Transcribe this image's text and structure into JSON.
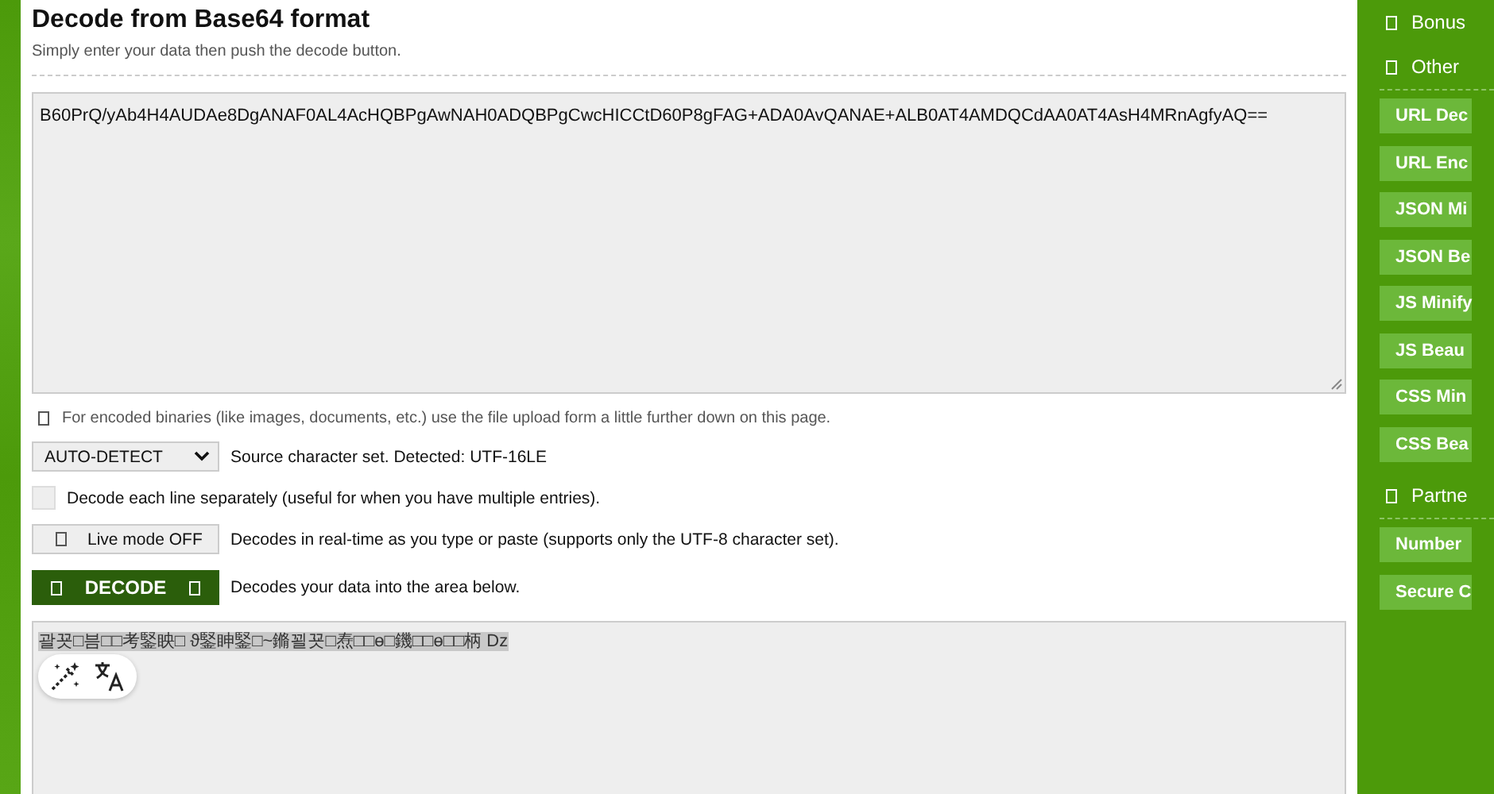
{
  "header": {
    "title": "Decode from Base64 format",
    "subtitle": "Simply enter your data then push the decode button."
  },
  "input": {
    "value": "B60PrQ/yAb4H4AUDAe8DgANAF0AL4AcHQBPgAwNAH0ADQBPgCwcHICCtD60P8gFAG+ADA0AvQANAE+ALB0AT4AMDQCdAA0AT4AsH4MRnAgfyAQ=="
  },
  "note": "For encoded binaries (like images, documents, etc.) use the file upload form a little further down on this page.",
  "charset": {
    "value": "AUTO-DETECT",
    "label": "Source character set. Detected: UTF-16LE"
  },
  "each_line": {
    "checked": false,
    "label": "Decode each line separately (useful for when you have multiple entries)."
  },
  "live_mode": {
    "label": "Live mode OFF",
    "on": false,
    "description": "Decodes in real-time as you type or paste (supports only the UTF-8 character set)."
  },
  "decode": {
    "label": "DECODE",
    "description": "Decodes your data into the area below."
  },
  "output": {
    "value": "괄꾯□븜□□考鋻眏□ ϑ鋻眒鋻□~鏅꾈꾯□焘□□ɵ□鐖□□ɵ□□柄 Dz"
  },
  "sidebar": [
    {
      "kind": "heading",
      "label": "Bonus"
    },
    {
      "kind": "heading",
      "label": "Other"
    },
    {
      "kind": "link",
      "label": "URL Dec"
    },
    {
      "kind": "link",
      "label": "URL Enc"
    },
    {
      "kind": "link",
      "label": "JSON Mi"
    },
    {
      "kind": "link",
      "label": "JSON Be"
    },
    {
      "kind": "link",
      "label": "JS Minify"
    },
    {
      "kind": "link",
      "label": "JS Beau"
    },
    {
      "kind": "link",
      "label": "CSS Min"
    },
    {
      "kind": "link",
      "label": "CSS Bea"
    },
    {
      "kind": "heading",
      "label": "Partne"
    },
    {
      "kind": "link",
      "label": "Number"
    },
    {
      "kind": "link",
      "label": "Secure C"
    }
  ]
}
